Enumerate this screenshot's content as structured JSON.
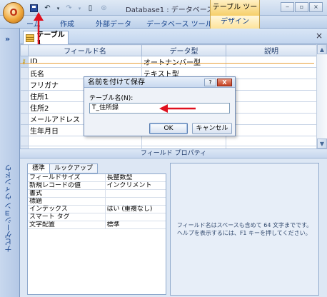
{
  "titlebar": {
    "office_button_glyph": "O",
    "title": "Database1 : データベース ...",
    "context_tab": "テーブル ツール",
    "qat_icons": [
      "save-icon",
      "undo-icon",
      "redo-icon",
      "new-icon",
      "dropdown-icon"
    ],
    "win_min": "‒",
    "win_max": "▫",
    "win_close": "×"
  },
  "ribbon": {
    "tabs": [
      "ーム",
      "作成",
      "外部データ",
      "データベース ツール",
      "デザイン"
    ]
  },
  "nav": {
    "chevron": "»",
    "label": "ナビゲーション ウィンドウ"
  },
  "document": {
    "tab_label": "テーブル1",
    "close": "×"
  },
  "grid": {
    "columns": [
      "フィールド名",
      "データ型",
      "説明"
    ],
    "rows": [
      {
        "name": "ID",
        "type": "オートナンバー型",
        "desc": "",
        "pk": true
      },
      {
        "name": "氏名",
        "type": "テキスト型",
        "desc": ""
      },
      {
        "name": "フリガナ",
        "type": "テキスト型",
        "desc": ""
      },
      {
        "name": "住所1",
        "type": "",
        "desc": ""
      },
      {
        "name": "住所2",
        "type": "",
        "desc": ""
      },
      {
        "name": "メールアドレス",
        "type": "",
        "desc": ""
      },
      {
        "name": "生年月日",
        "type": "",
        "desc": ""
      },
      {
        "name": "",
        "type": "",
        "desc": ""
      },
      {
        "name": "",
        "type": "",
        "desc": ""
      }
    ]
  },
  "field_properties": {
    "bar_label": "フィールド プロパティ",
    "tabs": [
      "標準",
      "ルックアップ"
    ],
    "rows": [
      {
        "label": "フィールドサイズ",
        "value": "長整数型"
      },
      {
        "label": "新規レコードの値",
        "value": "インクリメント"
      },
      {
        "label": "書式",
        "value": ""
      },
      {
        "label": "標題",
        "value": ""
      },
      {
        "label": "インデックス",
        "value": "はい (重複なし)"
      },
      {
        "label": "スマート タグ",
        "value": ""
      },
      {
        "label": "文字配置",
        "value": "標準"
      }
    ],
    "help_line1": "フィールド名はスペースも含めて 64 文字までです。",
    "help_line2": "ヘルプを表示するには、F1 キーを押してください。"
  },
  "dialog": {
    "title": "名前を付けて保存",
    "help_btn": "?",
    "close_btn": "X",
    "label": "テーブル名(N):",
    "value": "T_住所録",
    "ok": "OK",
    "cancel": "キャンセル"
  },
  "colors": {
    "annotation_arrow": "#e0101e",
    "ribbon_text": "#15428b"
  }
}
